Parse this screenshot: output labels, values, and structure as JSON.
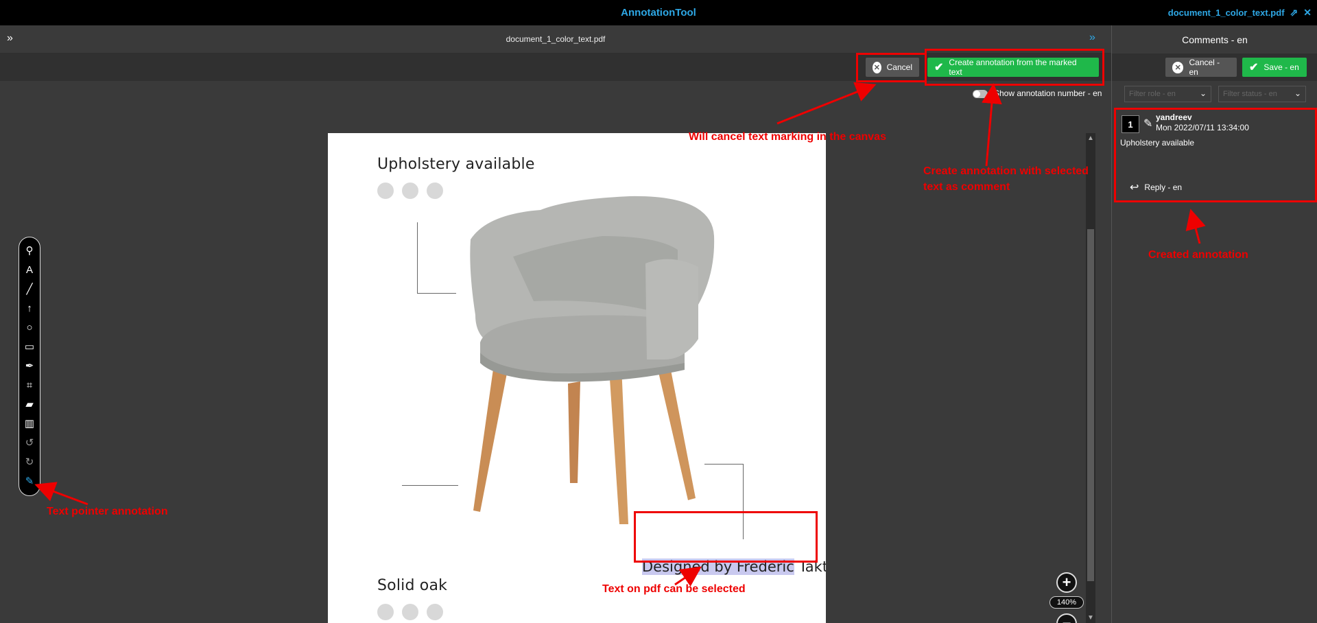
{
  "app": {
    "title": "AnnotationTool",
    "document_name": "document_1_color_text.pdf",
    "popout_icon": "external-link-icon",
    "close_icon": "close-icon"
  },
  "viewer": {
    "doc_title": "document_1_color_text.pdf",
    "cancel_label": "Cancel",
    "create_label": "Create annotation from the marked text",
    "show_number_label": "Show annotation number - en",
    "zoom_level": "140%"
  },
  "pdf": {
    "heading_top": "Upholstery available",
    "heading_bottom": "Solid oak",
    "designed_selected": "Designed by Frederic",
    "designed_rest": " Takt"
  },
  "tools": [
    {
      "name": "pin-icon",
      "glyph": "⚲"
    },
    {
      "name": "text-icon",
      "glyph": "A"
    },
    {
      "name": "line-icon",
      "glyph": "╱"
    },
    {
      "name": "arrow-icon",
      "glyph": "↑"
    },
    {
      "name": "circle-icon",
      "glyph": "○"
    },
    {
      "name": "rectangle-icon",
      "glyph": "▭"
    },
    {
      "name": "pen-icon",
      "glyph": "✒"
    },
    {
      "name": "polygon-icon",
      "glyph": "⌗"
    },
    {
      "name": "ruler-icon",
      "glyph": "▰"
    },
    {
      "name": "library-icon",
      "glyph": "▥"
    },
    {
      "name": "undo-icon",
      "glyph": "↺"
    },
    {
      "name": "redo-icon",
      "glyph": "↻"
    },
    {
      "name": "text-pointer-icon",
      "glyph": "✎"
    }
  ],
  "panel": {
    "title": "Comments - en",
    "cancel_label": "Cancel - en",
    "save_label": "Save - en",
    "filter_role": "Filter role - en",
    "filter_status": "Filter status - en"
  },
  "comment": {
    "number": "1",
    "author": "yandreev",
    "date": "Mon 2022/07/11 13:34:00",
    "text": "Upholstery available",
    "reply_label": "Reply - en"
  },
  "callouts": {
    "cancel_note": "Will cancel text marking in the canvas",
    "create_note_1": "Create annotation with selected",
    "create_note_2": "text as comment",
    "created_note": "Created annotation",
    "text_pointer_note": "Text pointer annotation",
    "selectable_note": "Text on pdf can be selected"
  },
  "colors": {
    "accent": "#2ea8e6",
    "green": "#1fb84a",
    "callout": "#ee0000",
    "selection": "#c9c9ef"
  }
}
